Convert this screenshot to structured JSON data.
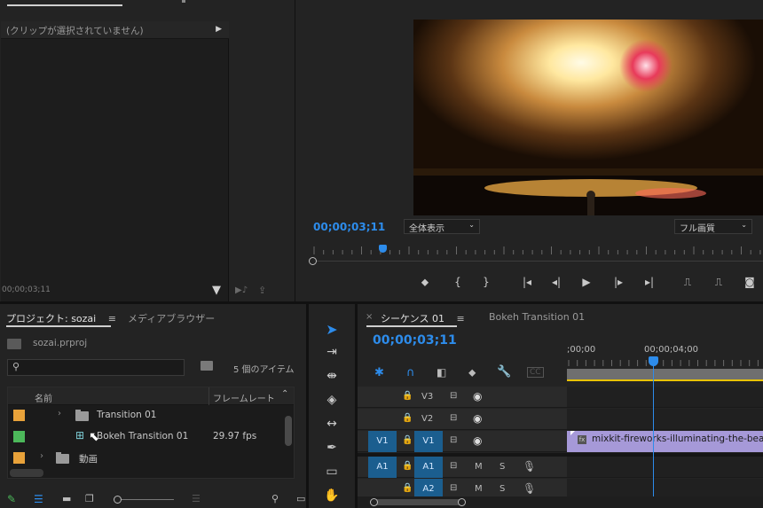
{
  "source": {
    "clip_header": "(クリップが選択されていません)",
    "timecode": "00;00;03;11"
  },
  "program": {
    "timecode": "00;00;03;11",
    "zoom": "全体表示",
    "quality": "フル画質"
  },
  "project": {
    "tab": "プロジェクト: sozai",
    "media_tab": "メディアブラウザー",
    "file": "sozai.prproj",
    "item_count": "5 個のアイテム",
    "col_name": "名前",
    "col_fps": "フレームレート",
    "items": [
      {
        "name": "Transition 01",
        "fps": "",
        "color": "#e8a23a"
      },
      {
        "name": "Bokeh Transition 01",
        "fps": "29.97 fps",
        "color": "#4cb85a"
      },
      {
        "name": "動画",
        "fps": "",
        "color": "#e8a23a"
      }
    ]
  },
  "timeline": {
    "seq_tab": "シーケンス 01",
    "other_tab": "Bokeh Transition 01",
    "timecode": "00;00;03;11",
    "ruler_labels": [
      ";00;00",
      "00;00;04;00"
    ],
    "tracks": [
      {
        "src": "",
        "name": "V3"
      },
      {
        "src": "",
        "name": "V2"
      },
      {
        "src": "V1",
        "name": "V1"
      },
      {
        "src": "A1",
        "name": "A1"
      },
      {
        "src": "",
        "name": "A2"
      }
    ],
    "mute": "M",
    "solo": "S",
    "clip_name": "mixkit-fireworks-illuminating-the-beach"
  }
}
